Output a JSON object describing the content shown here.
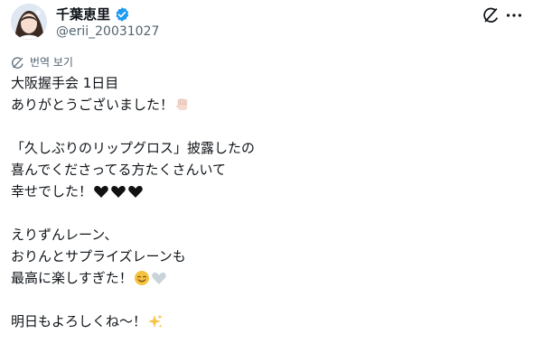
{
  "author": {
    "display_name": "千葉恵里",
    "handle": "@erii_20031027",
    "icons": {
      "verified": "verified-badge-icon",
      "avatar": "avatar"
    }
  },
  "actions": {
    "icons": [
      "grok-icon",
      "more-icon"
    ]
  },
  "translate": {
    "label": "번역 보기",
    "icon": "globe-icon"
  },
  "post": {
    "lines": [
      "大阪握手会 1日目",
      "ありがとうございました！",
      "",
      "「久しぶりのリップグロス」披露したの",
      "喜んでくださってる方たくさんいて",
      "幸せでした！",
      "",
      "えりずんレーン、",
      "おりんとサプライズレーンも",
      "最高に楽しすぎた！",
      "",
      "明日もよろしくね〜！"
    ],
    "emoji": {
      "line_2": [
        "raised-fist-icon"
      ],
      "line_6": [
        "black-heart-icon",
        "black-heart-icon",
        "black-heart-icon"
      ],
      "line_10": [
        "smiling-face-icon",
        "grey-heart-icon"
      ],
      "line_12": [
        "sparkles-icon"
      ]
    }
  },
  "colors": {
    "text": "#0f1419",
    "secondary_text": "#536471",
    "verified": "#1d9bf0"
  }
}
